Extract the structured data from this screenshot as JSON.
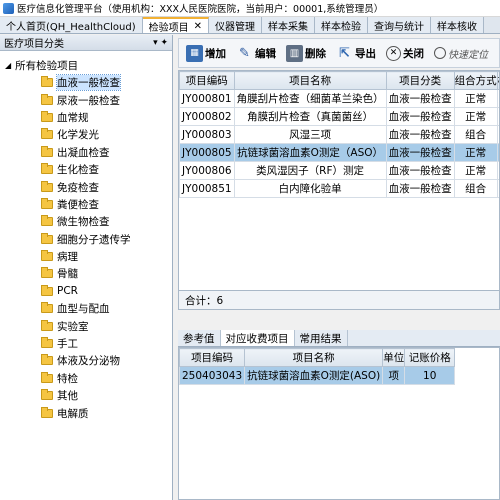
{
  "window": {
    "title": "医疗信息化管理平台（使用机构：XXX人民医院医院，当前用户：00001,系统管理员）"
  },
  "tabs": [
    {
      "label": "个人首页(QH_HealthCloud)"
    },
    {
      "label": "检验项目",
      "active": true,
      "close": "✕"
    },
    {
      "label": "仪器管理"
    },
    {
      "label": "样本采集"
    },
    {
      "label": "样本检验"
    },
    {
      "label": "查询与统计"
    },
    {
      "label": "样本核收"
    }
  ],
  "sidebar": {
    "title": "医疗项目分类",
    "pin": "▾ ✦",
    "root": "所有检验项目",
    "items": [
      {
        "label": "血液一般检查",
        "selected": true
      },
      {
        "label": "尿液一般检查"
      },
      {
        "label": "血常规"
      },
      {
        "label": "化学发光"
      },
      {
        "label": "出凝血检查"
      },
      {
        "label": "生化检查"
      },
      {
        "label": "免疫检查"
      },
      {
        "label": "粪便检查"
      },
      {
        "label": "微生物检查"
      },
      {
        "label": "细胞分子遗传学"
      },
      {
        "label": "病理"
      },
      {
        "label": "骨髓"
      },
      {
        "label": "PCR"
      },
      {
        "label": "血型与配血"
      },
      {
        "label": "实验室"
      },
      {
        "label": "手工"
      },
      {
        "label": "体液及分泌物"
      },
      {
        "label": "特检"
      },
      {
        "label": "其他"
      },
      {
        "label": "电解质"
      }
    ]
  },
  "toolbar": {
    "add": "增加",
    "edit": "编辑",
    "delete": "删除",
    "export": "导出",
    "close": "关闭",
    "quick_search": "快速定位"
  },
  "main_table": {
    "columns": [
      "项目编码",
      "项目名称",
      "项目分类",
      "组合方式",
      "检"
    ],
    "rows": [
      [
        "JY000801",
        "角膜刮片检查（细菌革兰染色）",
        "血液一般检查",
        "正常",
        ""
      ],
      [
        "JY000802",
        "角膜刮片检查（真菌菌丝）",
        "血液一般检查",
        "正常",
        ""
      ],
      [
        "JY000803",
        "风湿三项",
        "血液一般检查",
        "组合",
        ""
      ],
      [
        "JY000805",
        "抗链球菌溶血素O测定（ASO）",
        "血液一般检查",
        "正常",
        ""
      ],
      [
        "JY000806",
        "类风湿因子（RF）测定",
        "血液一般检查",
        "正常",
        ""
      ],
      [
        "JY000851",
        "白内障化验单",
        "血液一般检查",
        "组合",
        ""
      ]
    ],
    "selected_row": 3,
    "total": "合计：6"
  },
  "lower_tabs": [
    {
      "label": "参考值"
    },
    {
      "label": "对应收费项目",
      "active": true
    },
    {
      "label": "常用结果"
    }
  ],
  "fee_table": {
    "columns": [
      "项目编码",
      "项目名称",
      "单位",
      "记账价格"
    ],
    "rows": [
      [
        "250403043",
        "抗链球菌溶血素O测定(ASO)",
        "项",
        "10"
      ]
    ]
  }
}
